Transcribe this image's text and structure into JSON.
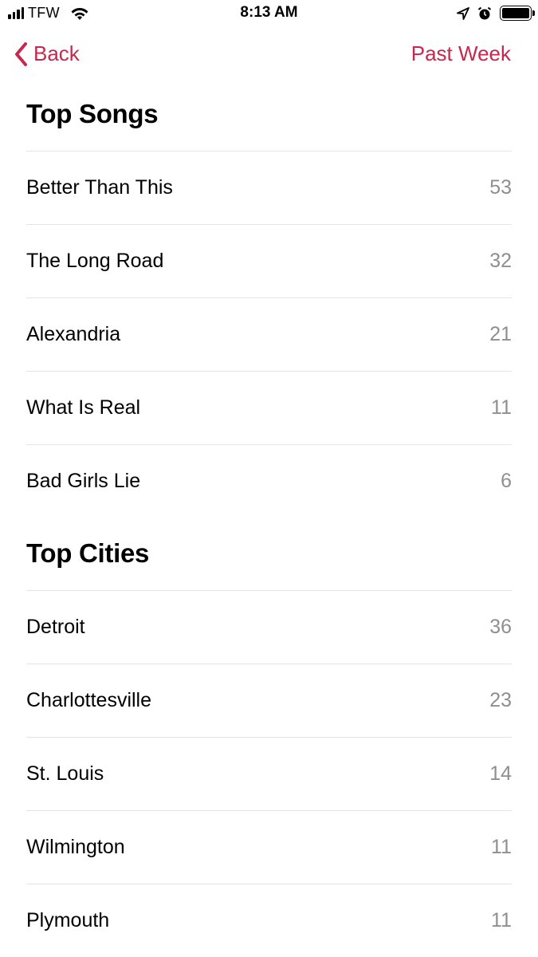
{
  "status_bar": {
    "carrier": "TFW",
    "time": "8:13 AM",
    "icons": [
      "signal-icon",
      "wifi-icon",
      "location-icon",
      "alarm-icon",
      "battery-icon"
    ]
  },
  "nav": {
    "back_label": "Back",
    "range_label": "Past Week",
    "accent_color": "#c6284e"
  },
  "top_songs": {
    "title": "Top Songs",
    "items": [
      {
        "name": "Better Than This",
        "count": "53"
      },
      {
        "name": "The Long Road",
        "count": "32"
      },
      {
        "name": "Alexandria",
        "count": "21"
      },
      {
        "name": "What Is Real",
        "count": "11"
      },
      {
        "name": "Bad Girls Lie",
        "count": "6"
      }
    ]
  },
  "top_cities": {
    "title": "Top Cities",
    "items": [
      {
        "name": "Detroit",
        "count": "36"
      },
      {
        "name": "Charlottesville",
        "count": "23"
      },
      {
        "name": "St. Louis",
        "count": "14"
      },
      {
        "name": "Wilmington",
        "count": "11"
      },
      {
        "name": "Plymouth",
        "count": "11"
      }
    ]
  }
}
